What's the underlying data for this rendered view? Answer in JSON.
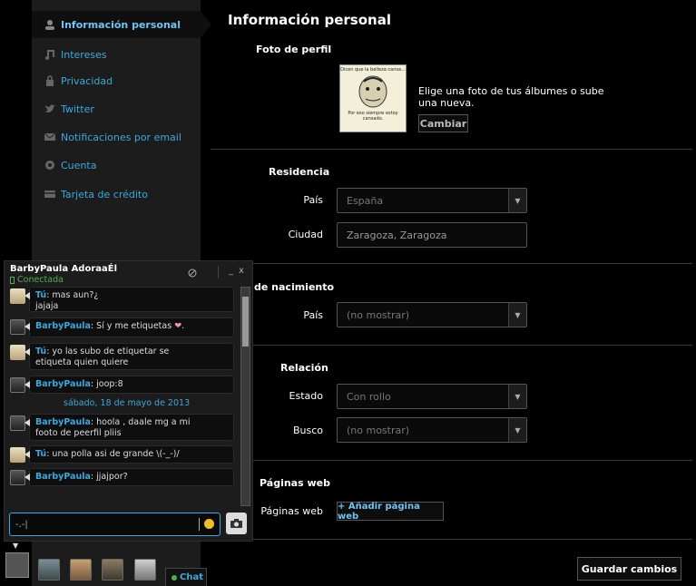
{
  "sidebar": {
    "items": [
      {
        "label": "Información personal",
        "icon": "user-icon"
      },
      {
        "label": "Intereses",
        "icon": "music-icon"
      },
      {
        "label": "Privacidad",
        "icon": "lock-icon"
      },
      {
        "label": "Twitter",
        "icon": "twitter-icon"
      },
      {
        "label": "Notificaciones por email",
        "icon": "mail-icon"
      },
      {
        "label": "Cuenta",
        "icon": "gear-icon"
      },
      {
        "label": "Tarjeta de crédito",
        "icon": "card-icon"
      }
    ]
  },
  "main": {
    "title": "Información personal",
    "photo": {
      "heading": "Foto de perfil",
      "meme_top": "Dicen que la belleza cansa...",
      "meme_bottom": "Por eso siempre estoy cansado.",
      "hint": "Elige una foto de tus álbumes o sube una nueva.",
      "change_button": "Cambiar"
    },
    "residence": {
      "heading": "Residencia",
      "country_label": "País",
      "country_value": "España",
      "city_label": "Ciudad",
      "city_value": "Zaragoza, Zaragoza"
    },
    "birth": {
      "heading": "de nacimiento",
      "country_label": "País",
      "country_value": "(no mostrar)"
    },
    "relationship": {
      "heading": "Relación",
      "status_label": "Estado",
      "status_value": "Con rollo",
      "seeking_label": "Busco",
      "seeking_value": "(no mostrar)"
    },
    "web": {
      "heading": "Páginas web",
      "label": "Páginas web",
      "add_button": "+ Añadir página web"
    },
    "save_button": "Guardar cambios"
  },
  "chat": {
    "contact_name": "BarbyPaula AdoraaÉl",
    "status": "Conectada",
    "messages": [
      {
        "author": "Tú",
        "text": ": mas aun?¿",
        "text2": "jajaja"
      },
      {
        "author": "BarbyPaula",
        "text": ": Sí y me etiquetas"
      },
      {
        "author": "Tú",
        "text": ": yo las subo de etiquetar se",
        "text2": "etiqueta quien quiere"
      },
      {
        "author": "BarbyPaula",
        "text": ": joop:8"
      },
      {
        "author": "BarbyPaula",
        "text": ": hoola , daale mg a mi",
        "text2": "footo de peerfil pliis"
      },
      {
        "author": "Tú",
        "text": ": una polla asi de grande \\(-_-)/"
      },
      {
        "author": "BarbyPaula",
        "text": ": jjajpor?"
      }
    ],
    "date_separator": "sábado, 18 de mayo de 2013",
    "input_value": "-.-|",
    "chat_tab": "Chat",
    "colors": {
      "accent": "#3aa9e0",
      "online": "#4caf50",
      "heart": "#f58fa8"
    }
  }
}
